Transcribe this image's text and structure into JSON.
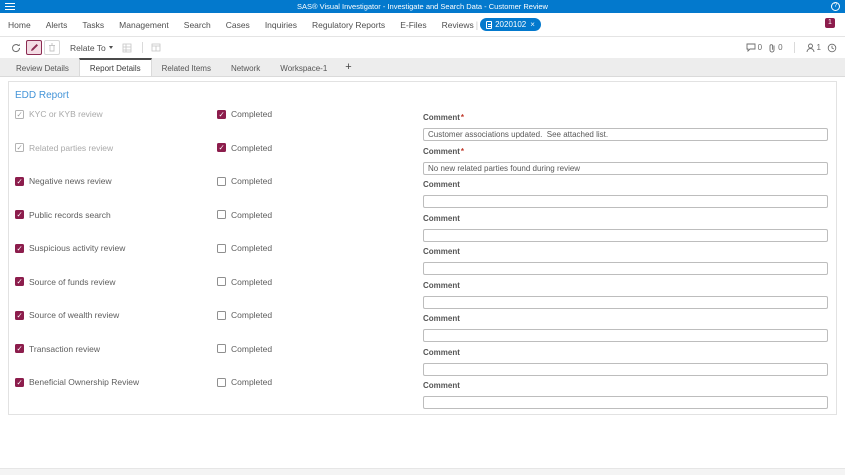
{
  "app": {
    "title": "SAS® Visual Investigator - Investigate and Search Data - Customer Review"
  },
  "nav": {
    "items": [
      "Home",
      "Alerts",
      "Tasks",
      "Management",
      "Search",
      "Cases",
      "Inquiries",
      "Regulatory Reports",
      "E-Files",
      "Reviews"
    ],
    "separator": "|",
    "open_record": {
      "label": "2020102",
      "close": "×"
    },
    "notification_count": "1"
  },
  "toolbar": {
    "relate_to_label": "Relate To",
    "comments_count": "0",
    "attachments_count": "0",
    "workflow_count": "1"
  },
  "tabs": {
    "items": [
      "Review Details",
      "Report Details",
      "Related Items",
      "Network",
      "Workspace-1"
    ],
    "active": "Report Details",
    "add_label": "+"
  },
  "report": {
    "title": "EDD Report",
    "completed_label": "Completed",
    "comment_label": "Comment",
    "required_marker": "*",
    "rows": [
      {
        "label": "KYC or KYB review",
        "item_checked": true,
        "item_disabled": true,
        "completed": true,
        "comment_required": true,
        "comment": "Customer associations updated.  See attached list."
      },
      {
        "label": "Related parties review",
        "item_checked": true,
        "item_disabled": true,
        "completed": true,
        "comment_required": true,
        "comment": "No new related parties found during review"
      },
      {
        "label": "Negative news review",
        "item_checked": true,
        "item_disabled": false,
        "completed": false,
        "comment_required": false,
        "comment": ""
      },
      {
        "label": "Public records search",
        "item_checked": true,
        "item_disabled": false,
        "completed": false,
        "comment_required": false,
        "comment": ""
      },
      {
        "label": "Suspicious activity review",
        "item_checked": true,
        "item_disabled": false,
        "completed": false,
        "comment_required": false,
        "comment": ""
      },
      {
        "label": "Source of funds review",
        "item_checked": true,
        "item_disabled": false,
        "completed": false,
        "comment_required": false,
        "comment": ""
      },
      {
        "label": "Source of wealth review",
        "item_checked": true,
        "item_disabled": false,
        "completed": false,
        "comment_required": false,
        "comment": ""
      },
      {
        "label": "Transaction review",
        "item_checked": true,
        "item_disabled": false,
        "completed": false,
        "comment_required": false,
        "comment": ""
      },
      {
        "label": "Beneficial Ownership Review",
        "item_checked": true,
        "item_disabled": false,
        "completed": false,
        "comment_required": false,
        "comment": ""
      }
    ]
  },
  "colors": {
    "app_bar_blue": "#0379CD",
    "accent_maroon": "#8C1D4C",
    "heading_blue": "#4394D8"
  }
}
